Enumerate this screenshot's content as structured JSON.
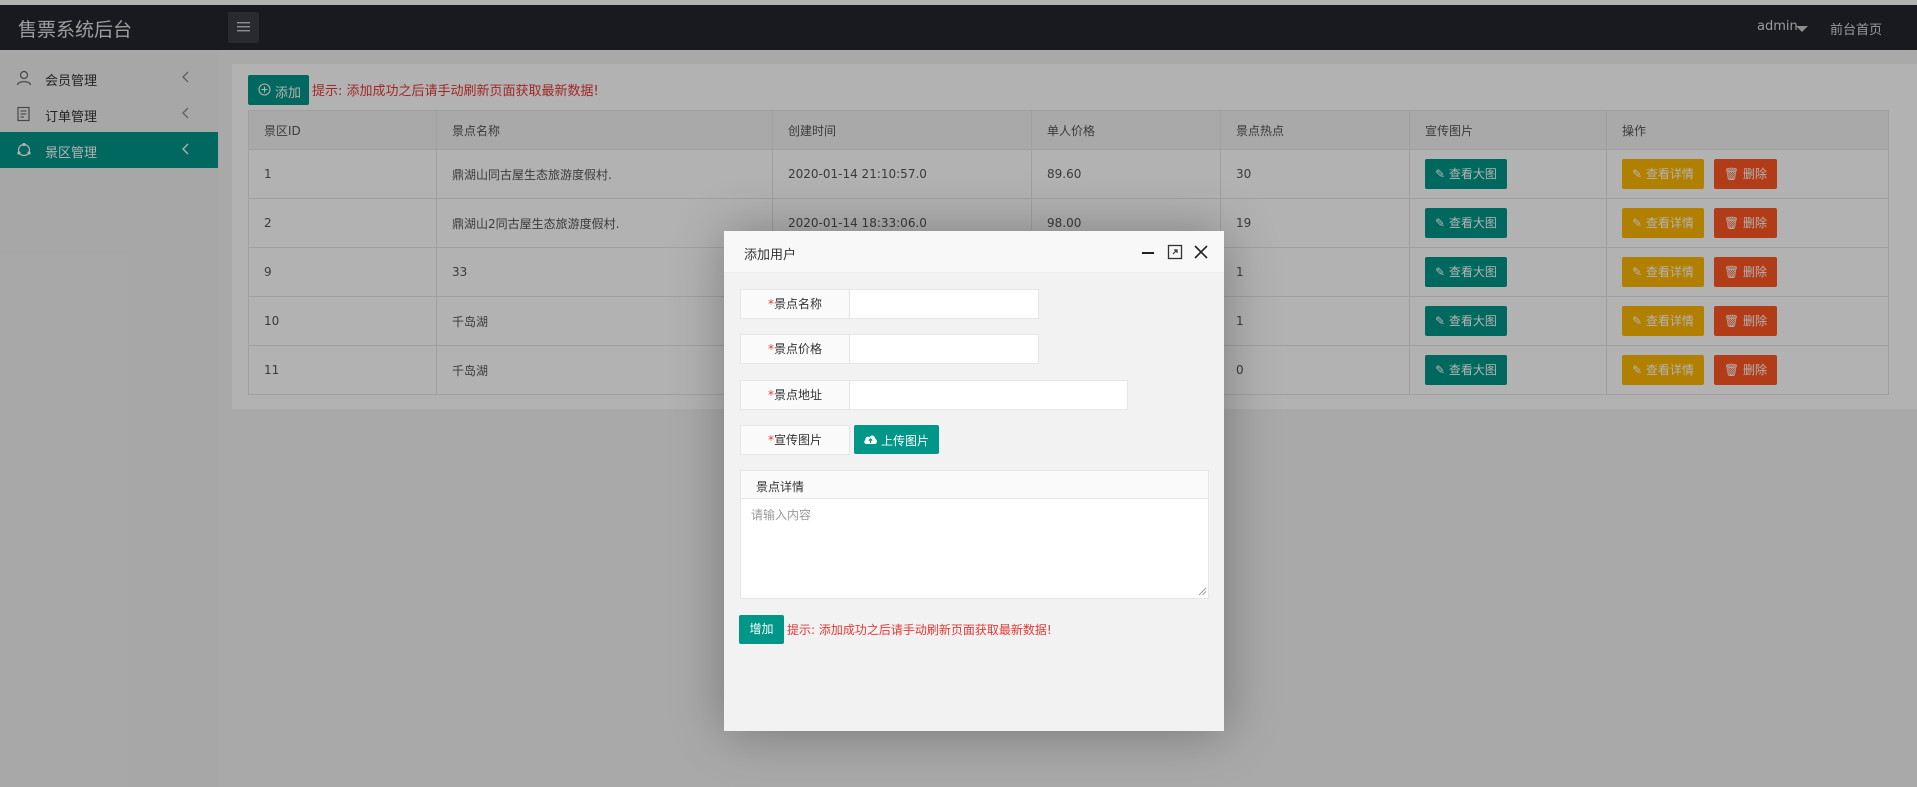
{
  "app": {
    "title": "售票系统后台"
  },
  "header": {
    "user": "admin",
    "home_link": "前台首页"
  },
  "sidebar": {
    "items": [
      {
        "label": "会员管理",
        "icon": "user-icon",
        "active": false
      },
      {
        "label": "订单管理",
        "icon": "order-icon",
        "active": false
      },
      {
        "label": "景区管理",
        "icon": "scenic-icon",
        "active": true
      }
    ]
  },
  "toolbar": {
    "add_label": "添加",
    "tip": "提示: 添加成功之后请手动刷新页面获取最新数据!"
  },
  "table": {
    "columns": [
      "景区ID",
      "景点名称",
      "创建时间",
      "单人价格",
      "景点热点",
      "宣传图片",
      "操作"
    ],
    "rows": [
      {
        "id": "1",
        "name": "鼎湖山同古屋生态旅游度假村.",
        "created": "2020-01-14 21:10:57.0",
        "price": "89.60",
        "hot": "30"
      },
      {
        "id": "2",
        "name": "鼎湖山2同古屋生态旅游度假村.",
        "created": "2020-01-14 18:33:06.0",
        "price": "98.00",
        "hot": "19"
      },
      {
        "id": "9",
        "name": "33",
        "created": "",
        "price": "",
        "hot": "1"
      },
      {
        "id": "10",
        "name": "千岛湖",
        "created": "",
        "price": "",
        "hot": "1"
      },
      {
        "id": "11",
        "name": "千岛湖",
        "created": "",
        "price": "",
        "hot": "0"
      }
    ],
    "action_view_image": "查看大图",
    "action_detail": "查看详情",
    "action_delete": "删除"
  },
  "modal": {
    "title": "添加用户",
    "required_mark": "*",
    "fields": {
      "name_label": "景点名称",
      "price_label": "景点价格",
      "address_label": "景点地址",
      "image_label": "宣传图片"
    },
    "upload_label": "上传图片",
    "detail_title": "景点详情",
    "detail_placeholder": "请输入内容",
    "submit_label": "增加",
    "tip": "提示: 添加成功之后请手动刷新页面获取最新数据!"
  },
  "colors": {
    "accent": "#009688",
    "warning": "#ffb800",
    "danger": "#ff5722",
    "tip": "#e53935",
    "header": "#23262e"
  }
}
